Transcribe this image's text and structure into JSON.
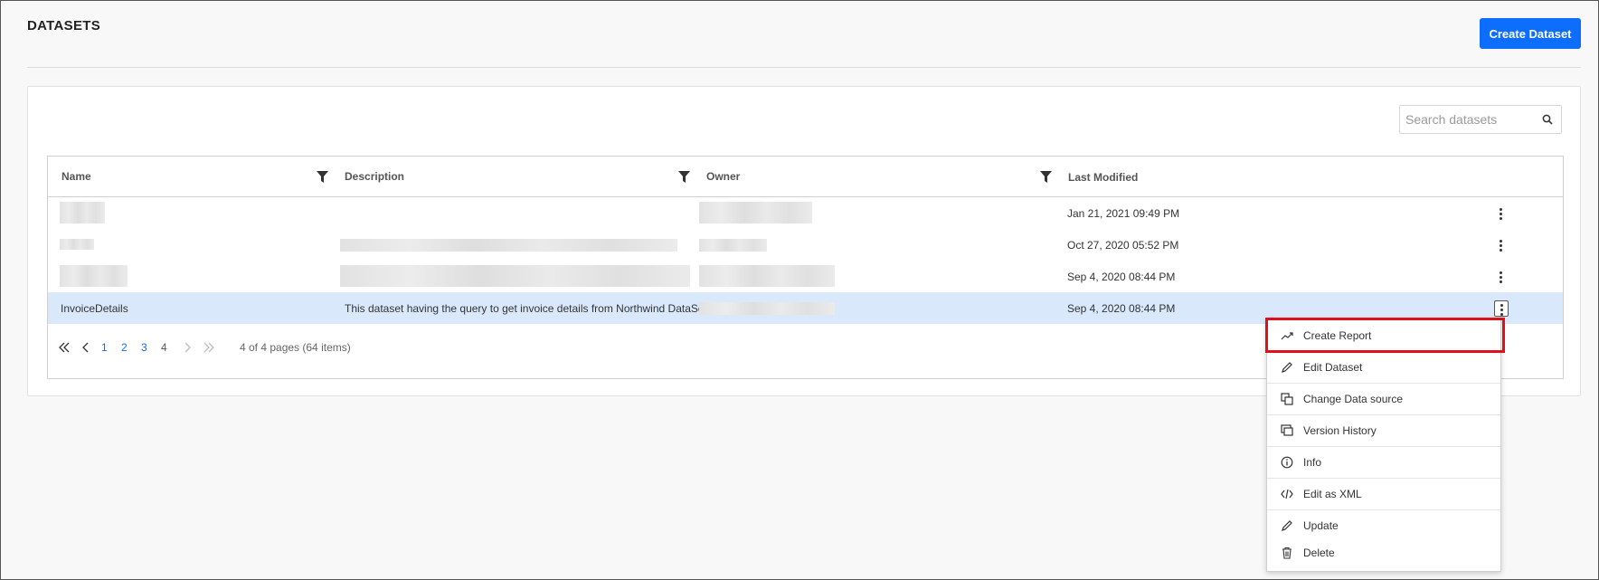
{
  "header": {
    "title": "DATASETS",
    "create_button": "Create Dataset"
  },
  "search": {
    "placeholder": "Search datasets"
  },
  "table": {
    "columns": [
      "Name",
      "Description",
      "Owner",
      "Last Modified"
    ],
    "rows": [
      {
        "name": "",
        "description": "",
        "owner": "",
        "last_modified": "Jan 21, 2021 09:49 PM"
      },
      {
        "name": "",
        "description": "",
        "owner": "",
        "last_modified": "Oct 27, 2020 05:52 PM"
      },
      {
        "name": "",
        "description": "",
        "owner": "",
        "last_modified": "Sep 4, 2020 08:44 PM"
      },
      {
        "name": "InvoiceDetails",
        "description": "This dataset having the query to get invoice details from Northwind DataSource.",
        "owner": "",
        "last_modified": "Sep 4, 2020 08:44 PM",
        "selected": true
      }
    ]
  },
  "pager": {
    "pages": [
      "1",
      "2",
      "3",
      "4"
    ],
    "current_page": "4",
    "info": "4 of 4 pages (64 items)"
  },
  "context_menu": {
    "items": [
      {
        "label": "Create Report",
        "icon": "trend-chart-icon",
        "highlighted": true
      },
      {
        "label": "Edit Dataset",
        "icon": "pencil-icon"
      },
      {
        "label": "Change Data source",
        "icon": "copy-icon"
      },
      {
        "label": "Version History",
        "icon": "history-icon"
      },
      {
        "label": "Info",
        "icon": "info-icon"
      },
      {
        "label": "Edit as XML",
        "icon": "code-icon"
      },
      {
        "label": "Update",
        "icon": "pencil-icon"
      },
      {
        "label": "Delete",
        "icon": "trash-icon"
      }
    ]
  },
  "colors": {
    "accent": "#0d6efd",
    "selected_row": "#dae8fc",
    "highlight_border": "#e0101a"
  }
}
